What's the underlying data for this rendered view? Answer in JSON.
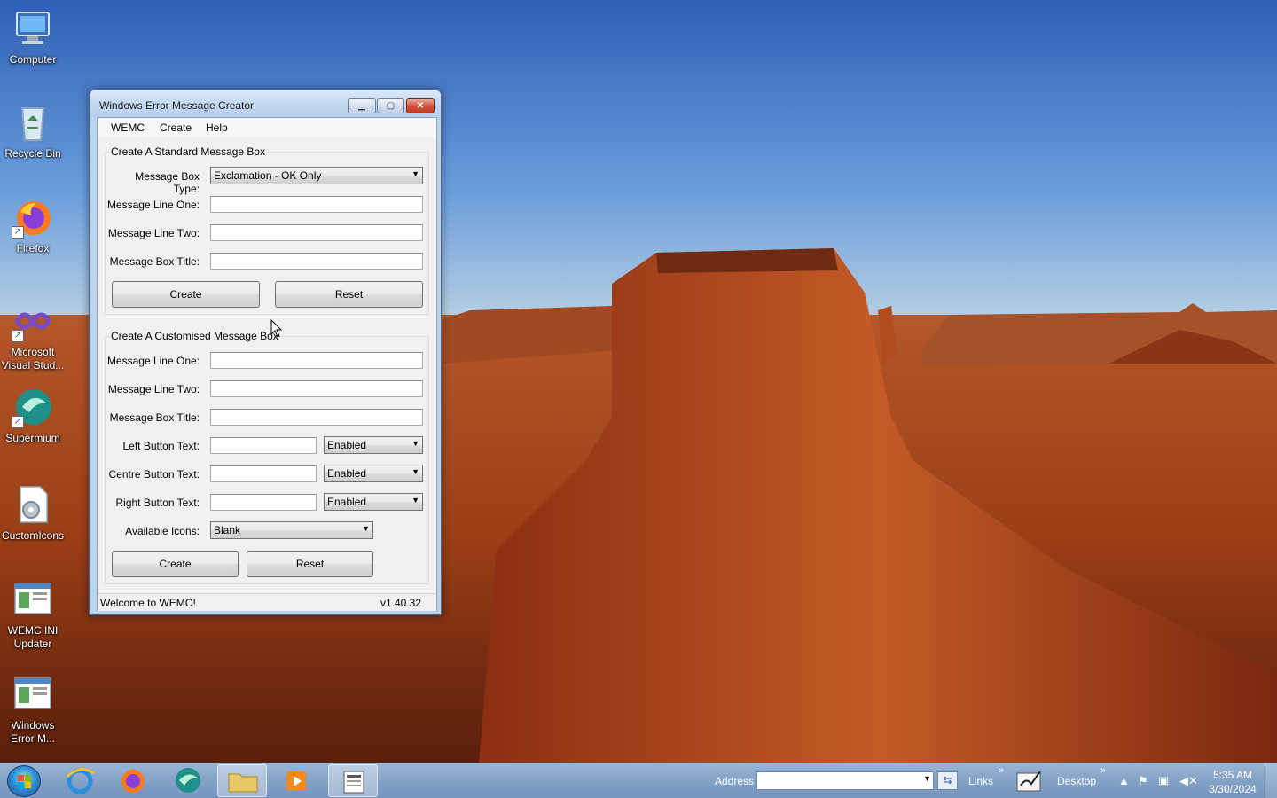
{
  "desktop": {
    "icons": [
      {
        "label": "Computer",
        "icon": "computer-icon"
      },
      {
        "label": "Recycle Bin",
        "icon": "recycle-bin-icon"
      },
      {
        "label": "Firefox",
        "icon": "firefox-icon"
      },
      {
        "label": "Microsoft Visual Stud...",
        "icon": "visual-studio-icon"
      },
      {
        "label": "Supermium",
        "icon": "supermium-icon"
      },
      {
        "label": "CustomIcons",
        "icon": "custom-icons-icon"
      },
      {
        "label": "WEMC INI Updater",
        "icon": "ini-updater-icon"
      },
      {
        "label": "Windows Error M...",
        "icon": "wemc-app-icon"
      }
    ]
  },
  "window": {
    "title": "Windows Error Message Creator",
    "menu": [
      "WEMC",
      "Create",
      "Help"
    ],
    "standard": {
      "group_label": "Create A Standard Message Box",
      "type_label": "Message Box Type:",
      "type_value": "Exclamation - OK Only",
      "line_one_label": "Message Line One:",
      "line_one_value": "",
      "line_two_label": "Message Line Two:",
      "line_two_value": "",
      "title_label": "Message Box Title:",
      "title_value": "",
      "create_label": "Create",
      "reset_label": "Reset"
    },
    "custom": {
      "group_label": "Create A Customised Message Box",
      "line_one_label": "Message Line One:",
      "line_two_label": "Message Line Two:",
      "title_label": "Message Box Title:",
      "left_button_label": "Left Button Text:",
      "left_button_state": "Enabled",
      "centre_button_label": "Centre Button Text:",
      "centre_button_state": "Enabled",
      "right_button_label": "Right Button Text:",
      "right_button_state": "Enabled",
      "icons_label": "Available Icons:",
      "icons_value": "Blank",
      "create_label": "Create",
      "reset_label": "Reset"
    },
    "status": {
      "message": "Welcome to WEMC!",
      "version": "v1.40.32"
    }
  },
  "taskbar": {
    "address_label": "Address",
    "address_value": "",
    "links_label": "Links",
    "desktop_label": "Desktop",
    "chevron": "»",
    "time": "5:35 AM",
    "date": "3/30/2024"
  },
  "colors": {
    "accent": "#2f8fd8",
    "close_button": "#c23a1f",
    "title_bar": "#c4d8f1"
  }
}
